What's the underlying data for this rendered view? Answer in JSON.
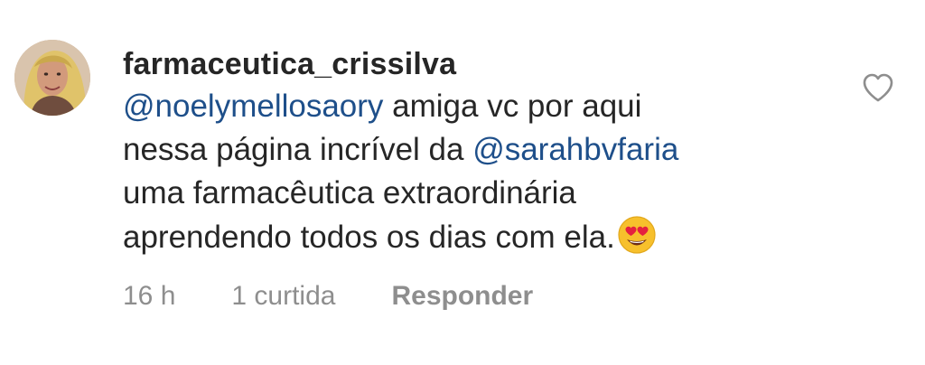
{
  "comment": {
    "username": "farmaceutica_crissilva",
    "text_segments": [
      "@noelymellosaory",
      " amiga vc por aqui",
      "nessa página incrível da ",
      "@sarahbvfaria",
      "uma farmacêutica extraordinária",
      "aprendendo todos os dias com ela."
    ],
    "emoji": "smiling-face-with-heart-eyes",
    "time": "16 h",
    "likes": "1 curtida",
    "reply_label": "Responder",
    "like_icon": "heart-outline-icon"
  },
  "colors": {
    "mention": "#1e4f8a",
    "text": "#262626",
    "meta": "#8e8e8e"
  }
}
